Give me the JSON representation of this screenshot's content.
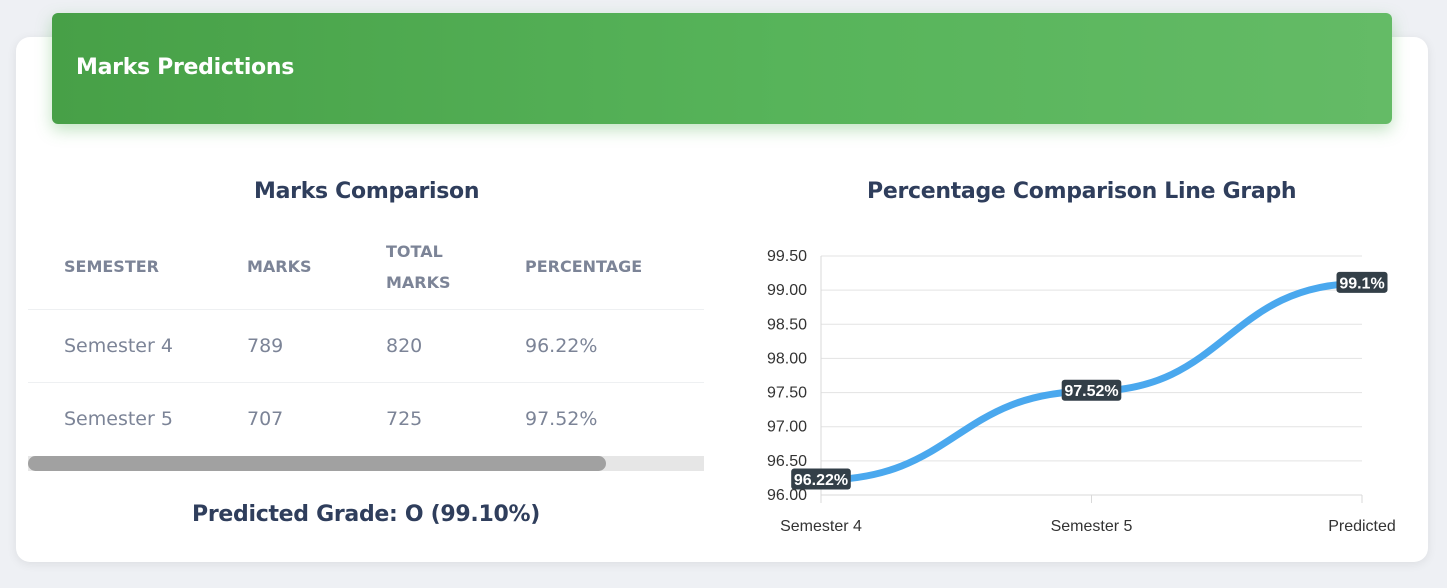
{
  "header": {
    "title": "Marks Predictions"
  },
  "table_section": {
    "title": "Marks Comparison",
    "columns": [
      "SEMESTER",
      "MARKS",
      "TOTAL MARKS",
      "PERCENTAGE"
    ],
    "rows": [
      [
        "Semester 4",
        "789",
        "820",
        "96.22%"
      ],
      [
        "Semester 5",
        "707",
        "725",
        "97.52%"
      ]
    ],
    "scroll_position": 0.855
  },
  "prediction": {
    "text": "Predicted Grade: O (99.10%)"
  },
  "chart_section": {
    "title": "Percentage Comparison Line Graph"
  },
  "chart_data": {
    "type": "line",
    "title": "Percentage Comparison Line Graph",
    "categories": [
      "Semester 4",
      "Semester 5",
      "Predicted"
    ],
    "series": [
      {
        "values": [
          96.22,
          97.52,
          99.1
        ],
        "labels": [
          "96.22%",
          "97.52%",
          "99.1%"
        ],
        "color": "#4aa8ee"
      }
    ],
    "yticks": [
      "96.00",
      "96.50",
      "97.00",
      "97.50",
      "98.00",
      "98.50",
      "99.00",
      "99.50"
    ],
    "ylim": [
      96,
      99.5
    ],
    "grid": true,
    "xlabel": "",
    "ylabel": ""
  },
  "colors": {
    "header_green": "#4caf50",
    "line_blue": "#4aa8ee",
    "title_navy": "#2f3e5c",
    "label_dark": "#333f48"
  }
}
